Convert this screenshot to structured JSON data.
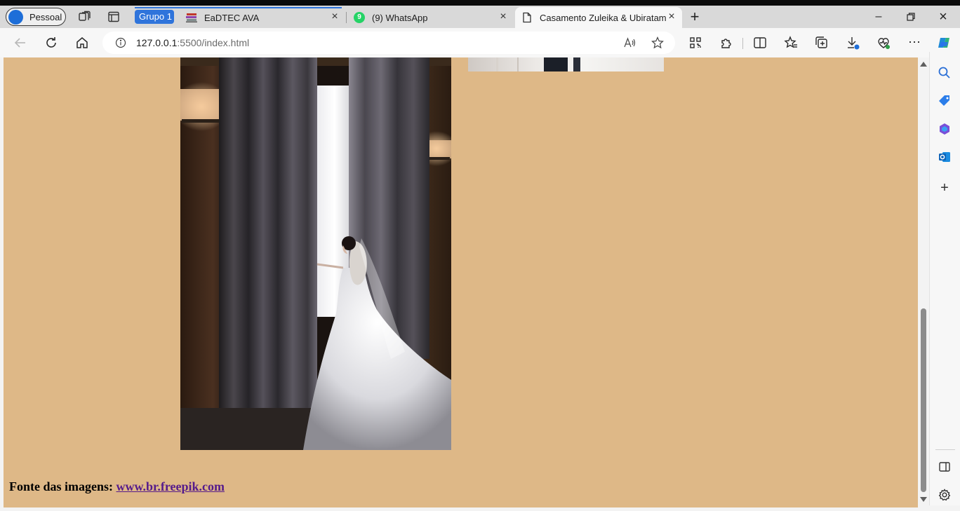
{
  "browser": {
    "profile_label": "Pessoal",
    "tab_group_label": "Grupo 1",
    "tabs": [
      {
        "title": "EaDTEC AVA",
        "icon": "books-icon"
      },
      {
        "title": "(9) WhatsApp",
        "icon": "whatsapp-icon",
        "badge": "9"
      },
      {
        "title": "Casamento Zuleika & Ubiratam",
        "icon": "page-icon",
        "active": true
      }
    ],
    "address": {
      "host": "127.0.0.1",
      "rest": ":5500/index.html"
    },
    "accent_color": "#2f74db"
  },
  "page": {
    "background_color": "#deb887",
    "credit_label": "Fonte das imagens: ",
    "credit_link": "www.br.freepik.com"
  }
}
